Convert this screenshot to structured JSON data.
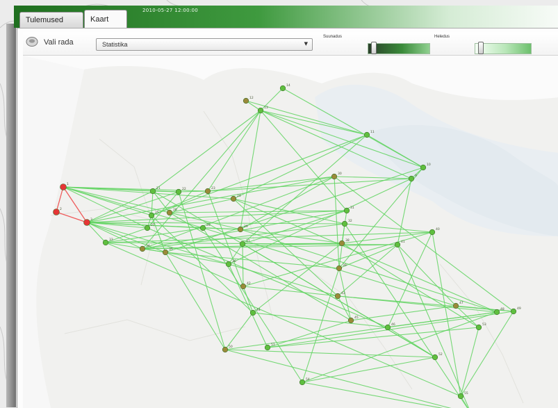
{
  "header": {
    "timestamp": "2010-05-27 12:00:00",
    "tabs": [
      {
        "label": "Tulemused",
        "active": false
      },
      {
        "label": "Kaart",
        "active": true
      }
    ]
  },
  "toolbar": {
    "route_label": "Vali rada",
    "route_select_value": "Statistika",
    "direction_label": "Suunadus",
    "speed_label": "Heledus",
    "direction_value": 0.05,
    "speed_value": 0.05
  },
  "colors": {
    "accent": "#3f9a3f",
    "edge": "#5fd35f",
    "node_green": "#5fbf3f",
    "node_brown": "#9a8a3a",
    "node_red": "#e53535",
    "edge_red": "#ef5b5b"
  },
  "icons": {
    "route_icon": "route-disc-icon",
    "select_arrow": "chevron-down-icon"
  },
  "map": {
    "nodes": [
      {
        "id": "n1",
        "label": "14",
        "color": "green"
      },
      {
        "id": "n2",
        "label": "12",
        "color": "brown"
      },
      {
        "id": "n3",
        "label": "13",
        "color": "green"
      },
      {
        "id": "n4",
        "label": "11",
        "color": "green"
      },
      {
        "id": "n5",
        "label": "10",
        "color": "green"
      },
      {
        "id": "n6",
        "label": "9",
        "color": "green"
      },
      {
        "id": "n7",
        "label": "1",
        "color": "red"
      },
      {
        "id": "n8",
        "label": "2",
        "color": "red"
      },
      {
        "id": "n9",
        "label": "3",
        "color": "red"
      },
      {
        "id": "n10",
        "label": "21",
        "color": "green"
      },
      {
        "id": "n11",
        "label": "22",
        "color": "green"
      },
      {
        "id": "n12",
        "label": "23",
        "color": "brown"
      },
      {
        "id": "n13",
        "label": "24",
        "color": "brown"
      },
      {
        "id": "n14",
        "label": "25",
        "color": "green"
      },
      {
        "id": "n15",
        "label": "26",
        "color": "brown"
      },
      {
        "id": "n16",
        "label": "27",
        "color": "green"
      },
      {
        "id": "n17",
        "label": "28",
        "color": "green"
      },
      {
        "id": "n18",
        "label": "29",
        "color": "brown"
      },
      {
        "id": "n19",
        "label": "30",
        "color": "brown"
      },
      {
        "id": "n20",
        "label": "31",
        "color": "green"
      },
      {
        "id": "n21",
        "label": "32",
        "color": "green"
      },
      {
        "id": "n22",
        "label": "33",
        "color": "green"
      },
      {
        "id": "n23",
        "label": "34",
        "color": "brown"
      },
      {
        "id": "n24",
        "label": "35",
        "color": "brown"
      },
      {
        "id": "n25",
        "label": "36",
        "color": "green"
      },
      {
        "id": "n26",
        "label": "37",
        "color": "green"
      },
      {
        "id": "n27",
        "label": "38",
        "color": "brown"
      },
      {
        "id": "n28",
        "label": "39",
        "color": "brown"
      },
      {
        "id": "n29",
        "label": "40",
        "color": "green"
      },
      {
        "id": "n30",
        "label": "41",
        "color": "green"
      },
      {
        "id": "n31",
        "label": "42",
        "color": "brown"
      },
      {
        "id": "n32",
        "label": "43",
        "color": "brown"
      },
      {
        "id": "n33",
        "label": "44",
        "color": "green"
      },
      {
        "id": "n34",
        "label": "45",
        "color": "brown"
      },
      {
        "id": "n35",
        "label": "46",
        "color": "green"
      },
      {
        "id": "n36",
        "label": "47",
        "color": "brown"
      },
      {
        "id": "n37",
        "label": "48",
        "color": "green"
      },
      {
        "id": "n38",
        "label": "49",
        "color": "green"
      },
      {
        "id": "n39",
        "label": "50",
        "color": "brown"
      },
      {
        "id": "n40",
        "label": "51",
        "color": "green"
      },
      {
        "id": "n41",
        "label": "52",
        "color": "green"
      },
      {
        "id": "n42",
        "label": "53",
        "color": "green"
      },
      {
        "id": "n43",
        "label": "54",
        "color": "green"
      },
      {
        "id": "n44",
        "label": "55",
        "color": "green"
      },
      {
        "id": "n45",
        "label": "56",
        "color": "brown"
      }
    ],
    "red_edges": [
      [
        "n7",
        "n8"
      ],
      [
        "n8",
        "n9"
      ],
      [
        "n7",
        "n9"
      ]
    ],
    "edges": [
      [
        "n1",
        "n3"
      ],
      [
        "n2",
        "n3"
      ],
      [
        "n3",
        "n4"
      ],
      [
        "n3",
        "n5"
      ],
      [
        "n3",
        "n6"
      ],
      [
        "n1",
        "n5"
      ],
      [
        "n2",
        "n4"
      ],
      [
        "n4",
        "n5"
      ],
      [
        "n5",
        "n6"
      ],
      [
        "n6",
        "n12"
      ],
      [
        "n3",
        "n10"
      ],
      [
        "n3",
        "n12"
      ],
      [
        "n3",
        "n18"
      ],
      [
        "n3",
        "n20"
      ],
      [
        "n3",
        "n23"
      ],
      [
        "n4",
        "n13"
      ],
      [
        "n4",
        "n14"
      ],
      [
        "n5",
        "n24"
      ],
      [
        "n6",
        "n19"
      ],
      [
        "n6",
        "n25"
      ],
      [
        "n7",
        "n10"
      ],
      [
        "n7",
        "n11"
      ],
      [
        "n7",
        "n12"
      ],
      [
        "n7",
        "n13"
      ],
      [
        "n7",
        "n14"
      ],
      [
        "n7",
        "n15"
      ],
      [
        "n7",
        "n16"
      ],
      [
        "n7",
        "n17"
      ],
      [
        "n9",
        "n10"
      ],
      [
        "n9",
        "n11"
      ],
      [
        "n9",
        "n16"
      ],
      [
        "n9",
        "n17"
      ],
      [
        "n9",
        "n18"
      ],
      [
        "n9",
        "n19"
      ],
      [
        "n9",
        "n20"
      ],
      [
        "n9",
        "n21"
      ],
      [
        "n9",
        "n22"
      ],
      [
        "n9",
        "n23"
      ],
      [
        "n9",
        "n24"
      ],
      [
        "n9",
        "n25"
      ],
      [
        "n10",
        "n11"
      ],
      [
        "n10",
        "n14"
      ],
      [
        "n10",
        "n15"
      ],
      [
        "n11",
        "n12"
      ],
      [
        "n11",
        "n16"
      ],
      [
        "n12",
        "n14"
      ],
      [
        "n12",
        "n19"
      ],
      [
        "n13",
        "n15"
      ],
      [
        "n13",
        "n21"
      ],
      [
        "n14",
        "n16"
      ],
      [
        "n14",
        "n24"
      ],
      [
        "n15",
        "n18"
      ],
      [
        "n15",
        "n20"
      ],
      [
        "n16",
        "n22"
      ],
      [
        "n17",
        "n18"
      ],
      [
        "n17",
        "n22"
      ],
      [
        "n18",
        "n19"
      ],
      [
        "n18",
        "n27"
      ],
      [
        "n19",
        "n23"
      ],
      [
        "n19",
        "n28"
      ],
      [
        "n20",
        "n23"
      ],
      [
        "n20",
        "n26"
      ],
      [
        "n21",
        "n23"
      ],
      [
        "n21",
        "n29"
      ],
      [
        "n22",
        "n24"
      ],
      [
        "n22",
        "n30"
      ],
      [
        "n23",
        "n24"
      ],
      [
        "n23",
        "n27"
      ],
      [
        "n24",
        "n25"
      ],
      [
        "n24",
        "n28"
      ],
      [
        "n24",
        "n31"
      ],
      [
        "n25",
        "n26"
      ],
      [
        "n25",
        "n32"
      ],
      [
        "n26",
        "n27"
      ],
      [
        "n26",
        "n31"
      ],
      [
        "n27",
        "n29"
      ],
      [
        "n27",
        "n33"
      ],
      [
        "n28",
        "n30"
      ],
      [
        "n28",
        "n34"
      ],
      [
        "n29",
        "n31"
      ],
      [
        "n29",
        "n35"
      ],
      [
        "n30",
        "n32"
      ],
      [
        "n30",
        "n36"
      ],
      [
        "n31",
        "n33"
      ],
      [
        "n31",
        "n37"
      ],
      [
        "n32",
        "n34"
      ],
      [
        "n32",
        "n38"
      ],
      [
        "n33",
        "n35"
      ],
      [
        "n33",
        "n39"
      ],
      [
        "n34",
        "n36"
      ],
      [
        "n34",
        "n40"
      ],
      [
        "n35",
        "n37"
      ],
      [
        "n35",
        "n41"
      ],
      [
        "n36",
        "n38"
      ],
      [
        "n36",
        "n42"
      ],
      [
        "n37",
        "n39"
      ],
      [
        "n37",
        "n43"
      ],
      [
        "n38",
        "n40"
      ],
      [
        "n38",
        "n44"
      ],
      [
        "n39",
        "n41"
      ],
      [
        "n39",
        "n45"
      ],
      [
        "n40",
        "n42"
      ],
      [
        "n41",
        "n43"
      ],
      [
        "n42",
        "n44"
      ],
      [
        "n43",
        "n45"
      ],
      [
        "n44",
        "n45"
      ],
      [
        "n20",
        "n27"
      ],
      [
        "n21",
        "n28"
      ],
      [
        "n22",
        "n29"
      ],
      [
        "n23",
        "n30"
      ],
      [
        "n12",
        "n31"
      ],
      [
        "n13",
        "n32"
      ],
      [
        "n14",
        "n33"
      ],
      [
        "n15",
        "n34"
      ],
      [
        "n16",
        "n35"
      ],
      [
        "n17",
        "n36"
      ],
      [
        "n18",
        "n37"
      ],
      [
        "n19",
        "n38"
      ],
      [
        "n24",
        "n39"
      ],
      [
        "n25",
        "n40"
      ],
      [
        "n26",
        "n41"
      ],
      [
        "n27",
        "n42"
      ],
      [
        "n28",
        "n43"
      ],
      [
        "n29",
        "n44"
      ],
      [
        "n30",
        "n45"
      ],
      [
        "n5",
        "n28"
      ],
      [
        "n6",
        "n30"
      ],
      [
        "n4",
        "n26"
      ],
      [
        "n13",
        "n37"
      ],
      [
        "n11",
        "n39"
      ],
      [
        "n10",
        "n41"
      ],
      [
        "n17",
        "n43"
      ],
      [
        "n21",
        "n45"
      ],
      [
        "n22",
        "n44"
      ]
    ]
  }
}
